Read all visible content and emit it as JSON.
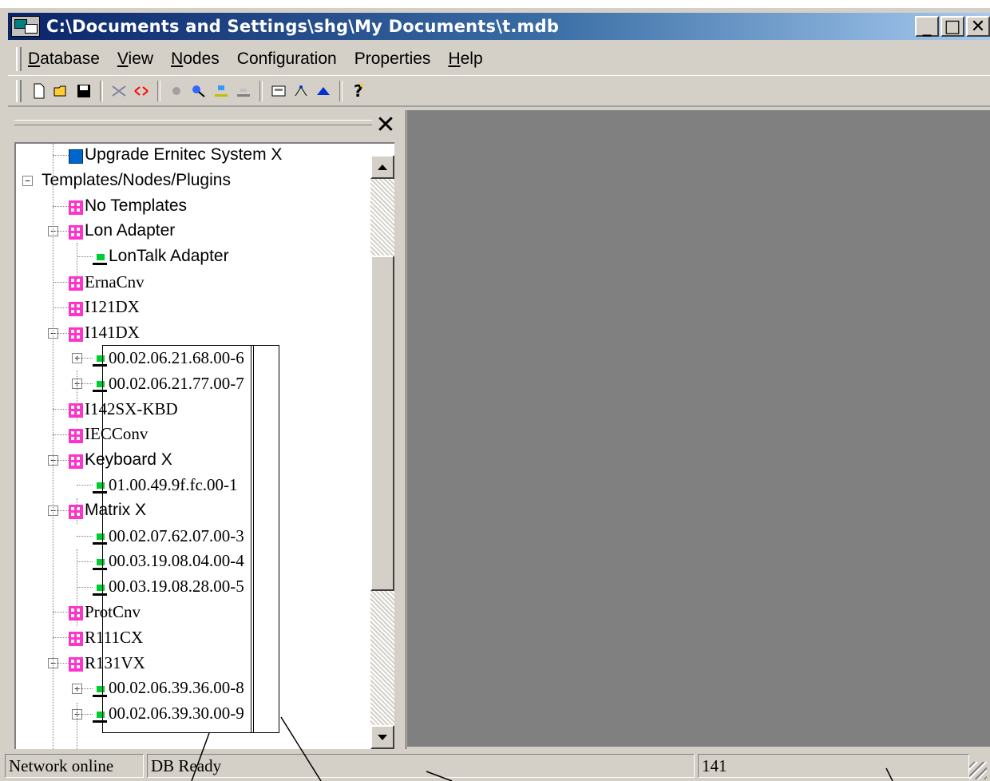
{
  "window": {
    "title": "C:\\Documents and Settings\\shg\\My Documents\\t.mdb"
  },
  "title_buttons": {
    "minimize": "_",
    "maximize": "□",
    "close": "✕"
  },
  "menu": [
    {
      "pre": "",
      "u": "D",
      "post": "atabase"
    },
    {
      "pre": "",
      "u": "V",
      "post": "iew"
    },
    {
      "pre": "",
      "u": "N",
      "post": "odes"
    },
    {
      "pre": "Confi",
      "u": "g",
      "post": "uration"
    },
    {
      "pre": "Properties",
      "u": "",
      "post": ""
    },
    {
      "pre": "",
      "u": "H",
      "post": "elp"
    }
  ],
  "toolbar_icons": [
    "new-icon",
    "open-icon",
    "save-icon",
    "sep",
    "cut-icon",
    "link-icon",
    "sep",
    "view-icon",
    "find-icon",
    "upload-icon",
    "download-icon",
    "sep",
    "window-icon",
    "tree-icon",
    "network-icon",
    "sep",
    "help-icon"
  ],
  "pane": {
    "close": "✕"
  },
  "tree": [
    {
      "label": "Upgrade Ernitec System X",
      "icon": "upgrade",
      "level": 2,
      "expander": "",
      "sans": true
    },
    {
      "label": "Templates/Nodes/Plugins",
      "icon": "",
      "level": 0,
      "expander": "−",
      "sans": true
    },
    {
      "label": "No Templates",
      "icon": "pink",
      "level": 2,
      "expander": "",
      "sans": true
    },
    {
      "label": "Lon Adapter",
      "icon": "pink",
      "level": 2,
      "expander": "−",
      "sans": true
    },
    {
      "label": "LonTalk Adapter",
      "icon": "green",
      "level": 3,
      "expander": "",
      "sans": true
    },
    {
      "label": "ErnaCnv",
      "icon": "pink",
      "level": 2,
      "expander": "",
      "sans": false
    },
    {
      "label": "I121DX",
      "icon": "pink",
      "level": 2,
      "expander": "",
      "sans": false
    },
    {
      "label": "I141DX",
      "icon": "pink",
      "level": 2,
      "expander": "−",
      "sans": false
    },
    {
      "label": "00.02.06.21.68.00-6",
      "icon": "green",
      "level": 3,
      "expander": "+",
      "sans": false
    },
    {
      "label": "00.02.06.21.77.00-7",
      "icon": "green",
      "level": 3,
      "expander": "+",
      "sans": false
    },
    {
      "label": "I142SX-KBD",
      "icon": "pink",
      "level": 2,
      "expander": "",
      "sans": false
    },
    {
      "label": "IECConv",
      "icon": "pink",
      "level": 2,
      "expander": "",
      "sans": false
    },
    {
      "label": "Keyboard X",
      "icon": "pink",
      "level": 2,
      "expander": "−",
      "sans": true
    },
    {
      "label": "01.00.49.9f.fc.00-1",
      "icon": "green",
      "level": 3,
      "expander": "",
      "sans": false
    },
    {
      "label": "Matrix X",
      "icon": "pink",
      "level": 2,
      "expander": "−",
      "sans": true
    },
    {
      "label": "00.02.07.62.07.00-3",
      "icon": "green",
      "level": 3,
      "expander": "",
      "sans": false
    },
    {
      "label": "00.03.19.08.04.00-4",
      "icon": "green",
      "level": 3,
      "expander": "",
      "sans": false
    },
    {
      "label": "00.03.19.08.28.00-5",
      "icon": "green",
      "level": 3,
      "expander": "",
      "sans": false
    },
    {
      "label": "ProtCnv",
      "icon": "pink",
      "level": 2,
      "expander": "",
      "sans": false
    },
    {
      "label": "R111CX",
      "icon": "pink",
      "level": 2,
      "expander": "",
      "sans": false
    },
    {
      "label": "R131VX",
      "icon": "pink",
      "level": 2,
      "expander": "−",
      "sans": false
    },
    {
      "label": "00.02.06.39.36.00-8",
      "icon": "green",
      "level": 3,
      "expander": "+",
      "sans": false
    },
    {
      "label": "00.02.06.39.30.00-9",
      "icon": "green",
      "level": 3,
      "expander": "+",
      "sans": false
    }
  ],
  "status": {
    "network": "Network online",
    "db": "DB Ready",
    "count": "141"
  },
  "colors": {
    "titlebar_start": "#0a246a",
    "titlebar_end": "#a6caf0",
    "node_pink": "#ff33cc",
    "node_green": "#00cc33",
    "right_pane": "#808080",
    "face": "#d4d0c8"
  }
}
